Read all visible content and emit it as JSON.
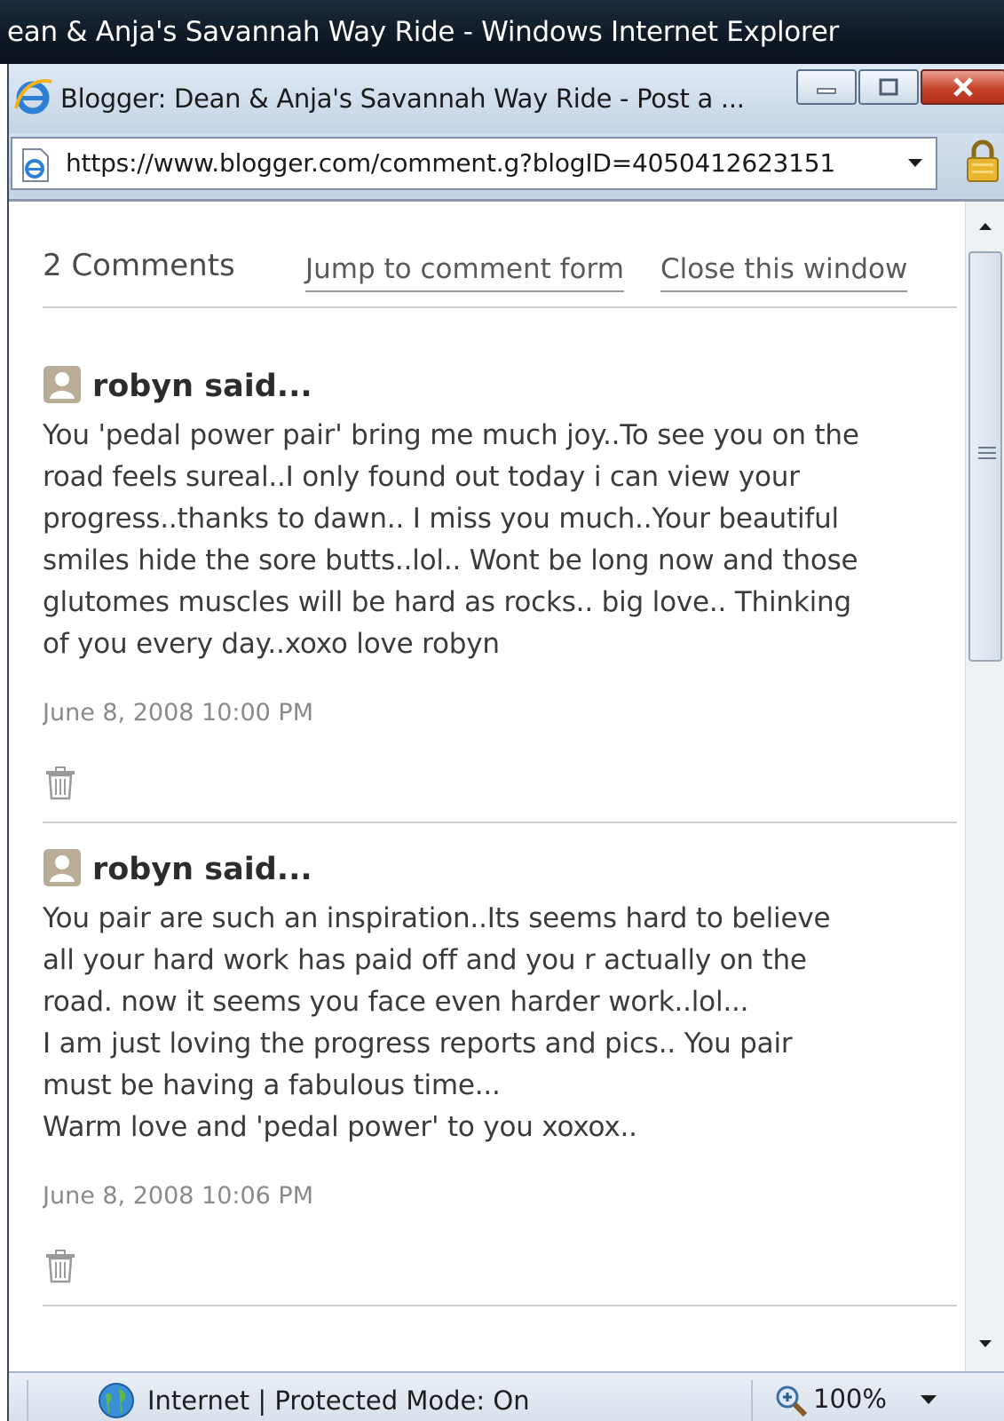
{
  "outer_window": {
    "title": "ean & Anja's Savannah Way Ride - Windows Internet Explorer"
  },
  "popup": {
    "title": "Blogger: Dean & Anja's Savannah Way Ride - Post a ...",
    "address": "https://www.blogger.com/comment.g?blogID=4050412623151"
  },
  "header": {
    "count_label": "2 Comments",
    "jump_link": "Jump to comment form",
    "close_link": "Close this window"
  },
  "comments": [
    {
      "author": "robyn said...",
      "body_lines": [
        "You 'pedal power pair' bring me much joy..To see you on the",
        "road feels sureal..I only found out today i can view your",
        "progress..thanks to dawn.. I miss you much..Your beautiful",
        "smiles hide the sore butts..lol.. Wont be long now and those",
        "glutomes muscles will be hard as rocks.. big love.. Thinking",
        "of you every day..xoxo love robyn"
      ],
      "timestamp": "June 8, 2008 10:00 PM"
    },
    {
      "author": "robyn said...",
      "body_lines": [
        "You pair are such an inspiration..Its seems hard to believe",
        "all your hard work has paid off and you r actually on the",
        "road. now it seems you face even harder work..lol...",
        "I am just loving the progress reports and pics.. You pair",
        "must be having a fabulous time...",
        "Warm love and 'pedal power' to you xoxox.."
      ],
      "timestamp": "June 8, 2008 10:06 PM"
    }
  ],
  "statusbar": {
    "zone_text": "Internet | Protected Mode: On",
    "zoom": "100%"
  },
  "icons": {
    "browser": "ie-logo-icon",
    "lock": "lock-icon",
    "avatar": "user-avatar-icon",
    "delete": "trash-icon",
    "zone": "globe-icon",
    "zoom": "magnifier-icon"
  },
  "colors": {
    "title_bar": "#0c1722",
    "close_button": "#c5432b",
    "link_text": "#5a5a5a",
    "timestamp": "#8a8a8a"
  }
}
